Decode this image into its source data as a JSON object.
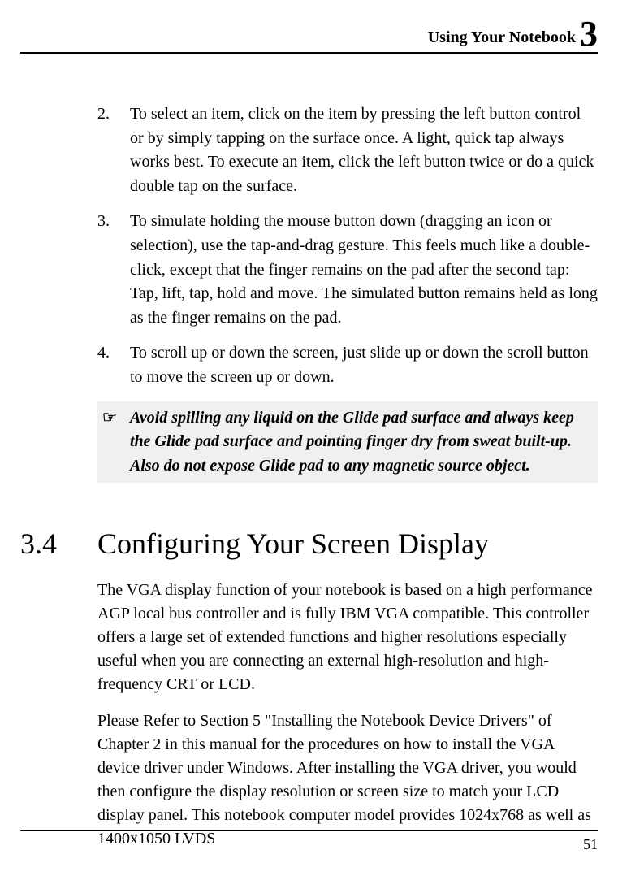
{
  "header": {
    "title_prefix": "Using Your Notebook ",
    "chapter_num": "3"
  },
  "list": {
    "items": [
      {
        "marker": "2.",
        "text": "To select an item, click on the item by pressing the left button control or by simply tapping on the surface once. A light, quick tap always works best. To execute an item, click the left button twice or do a quick double tap on the surface."
      },
      {
        "marker": "3.",
        "text": "To simulate holding the mouse button down (dragging an icon or selection), use the tap-and-drag gesture. This feels much like a double-click, except that the finger remains on the pad after the second tap: Tap, lift, tap, hold and move. The simulated button remains held as long as the finger remains on the pad."
      },
      {
        "marker": "4.",
        "text": "To scroll up or down the screen, just slide up or down the scroll button to move the screen up or down."
      }
    ]
  },
  "note": {
    "icon": "☞",
    "text": "Avoid spilling any liquid on the Glide pad surface and always keep the Glide pad surface and pointing finger dry from sweat built-up. Also do not expose Glide pad to any magnetic source object."
  },
  "section": {
    "number": "3.4",
    "title": "Configuring Your Screen Display",
    "para1": "The VGA display function of your notebook is based on a high performance AGP local bus controller and is fully IBM VGA compatible. This controller offers a large set of extended functions and higher resolutions especially useful when you are connecting an external high-resolution and high-frequency CRT or LCD.",
    "para2": "Please Refer to Section 5 \"Installing the Notebook Device Drivers\" of Chapter 2 in this manual for the procedures on how to install the VGA device driver under Windows. After installing the VGA driver, you would then configure the display resolution or screen size to match your LCD display panel. This notebook computer model provides 1024x768 as well as 1400x1050 LVDS"
  },
  "footer": {
    "page_number": "51"
  }
}
